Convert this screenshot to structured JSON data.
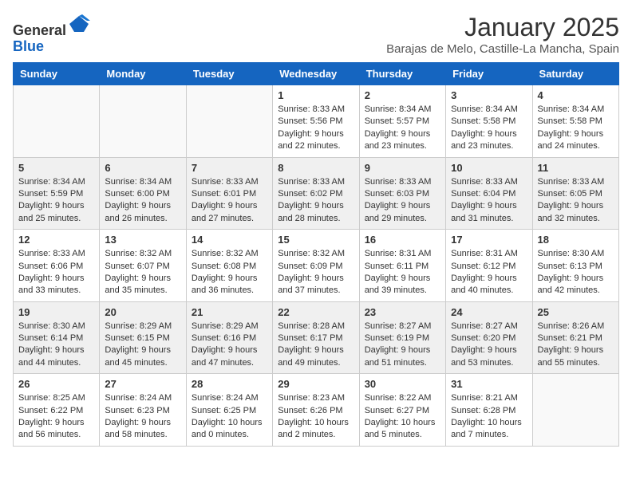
{
  "header": {
    "logo_general": "General",
    "logo_blue": "Blue",
    "month_title": "January 2025",
    "location": "Barajas de Melo, Castille-La Mancha, Spain"
  },
  "days_of_week": [
    "Sunday",
    "Monday",
    "Tuesday",
    "Wednesday",
    "Thursday",
    "Friday",
    "Saturday"
  ],
  "weeks": [
    [
      {
        "day": "",
        "info": ""
      },
      {
        "day": "",
        "info": ""
      },
      {
        "day": "",
        "info": ""
      },
      {
        "day": "1",
        "info": "Sunrise: 8:33 AM\nSunset: 5:56 PM\nDaylight: 9 hours\nand 22 minutes."
      },
      {
        "day": "2",
        "info": "Sunrise: 8:34 AM\nSunset: 5:57 PM\nDaylight: 9 hours\nand 23 minutes."
      },
      {
        "day": "3",
        "info": "Sunrise: 8:34 AM\nSunset: 5:58 PM\nDaylight: 9 hours\nand 23 minutes."
      },
      {
        "day": "4",
        "info": "Sunrise: 8:34 AM\nSunset: 5:58 PM\nDaylight: 9 hours\nand 24 minutes."
      }
    ],
    [
      {
        "day": "5",
        "info": "Sunrise: 8:34 AM\nSunset: 5:59 PM\nDaylight: 9 hours\nand 25 minutes."
      },
      {
        "day": "6",
        "info": "Sunrise: 8:34 AM\nSunset: 6:00 PM\nDaylight: 9 hours\nand 26 minutes."
      },
      {
        "day": "7",
        "info": "Sunrise: 8:33 AM\nSunset: 6:01 PM\nDaylight: 9 hours\nand 27 minutes."
      },
      {
        "day": "8",
        "info": "Sunrise: 8:33 AM\nSunset: 6:02 PM\nDaylight: 9 hours\nand 28 minutes."
      },
      {
        "day": "9",
        "info": "Sunrise: 8:33 AM\nSunset: 6:03 PM\nDaylight: 9 hours\nand 29 minutes."
      },
      {
        "day": "10",
        "info": "Sunrise: 8:33 AM\nSunset: 6:04 PM\nDaylight: 9 hours\nand 31 minutes."
      },
      {
        "day": "11",
        "info": "Sunrise: 8:33 AM\nSunset: 6:05 PM\nDaylight: 9 hours\nand 32 minutes."
      }
    ],
    [
      {
        "day": "12",
        "info": "Sunrise: 8:33 AM\nSunset: 6:06 PM\nDaylight: 9 hours\nand 33 minutes."
      },
      {
        "day": "13",
        "info": "Sunrise: 8:32 AM\nSunset: 6:07 PM\nDaylight: 9 hours\nand 35 minutes."
      },
      {
        "day": "14",
        "info": "Sunrise: 8:32 AM\nSunset: 6:08 PM\nDaylight: 9 hours\nand 36 minutes."
      },
      {
        "day": "15",
        "info": "Sunrise: 8:32 AM\nSunset: 6:09 PM\nDaylight: 9 hours\nand 37 minutes."
      },
      {
        "day": "16",
        "info": "Sunrise: 8:31 AM\nSunset: 6:11 PM\nDaylight: 9 hours\nand 39 minutes."
      },
      {
        "day": "17",
        "info": "Sunrise: 8:31 AM\nSunset: 6:12 PM\nDaylight: 9 hours\nand 40 minutes."
      },
      {
        "day": "18",
        "info": "Sunrise: 8:30 AM\nSunset: 6:13 PM\nDaylight: 9 hours\nand 42 minutes."
      }
    ],
    [
      {
        "day": "19",
        "info": "Sunrise: 8:30 AM\nSunset: 6:14 PM\nDaylight: 9 hours\nand 44 minutes."
      },
      {
        "day": "20",
        "info": "Sunrise: 8:29 AM\nSunset: 6:15 PM\nDaylight: 9 hours\nand 45 minutes."
      },
      {
        "day": "21",
        "info": "Sunrise: 8:29 AM\nSunset: 6:16 PM\nDaylight: 9 hours\nand 47 minutes."
      },
      {
        "day": "22",
        "info": "Sunrise: 8:28 AM\nSunset: 6:17 PM\nDaylight: 9 hours\nand 49 minutes."
      },
      {
        "day": "23",
        "info": "Sunrise: 8:27 AM\nSunset: 6:19 PM\nDaylight: 9 hours\nand 51 minutes."
      },
      {
        "day": "24",
        "info": "Sunrise: 8:27 AM\nSunset: 6:20 PM\nDaylight: 9 hours\nand 53 minutes."
      },
      {
        "day": "25",
        "info": "Sunrise: 8:26 AM\nSunset: 6:21 PM\nDaylight: 9 hours\nand 55 minutes."
      }
    ],
    [
      {
        "day": "26",
        "info": "Sunrise: 8:25 AM\nSunset: 6:22 PM\nDaylight: 9 hours\nand 56 minutes."
      },
      {
        "day": "27",
        "info": "Sunrise: 8:24 AM\nSunset: 6:23 PM\nDaylight: 9 hours\nand 58 minutes."
      },
      {
        "day": "28",
        "info": "Sunrise: 8:24 AM\nSunset: 6:25 PM\nDaylight: 10 hours\nand 0 minutes."
      },
      {
        "day": "29",
        "info": "Sunrise: 8:23 AM\nSunset: 6:26 PM\nDaylight: 10 hours\nand 2 minutes."
      },
      {
        "day": "30",
        "info": "Sunrise: 8:22 AM\nSunset: 6:27 PM\nDaylight: 10 hours\nand 5 minutes."
      },
      {
        "day": "31",
        "info": "Sunrise: 8:21 AM\nSunset: 6:28 PM\nDaylight: 10 hours\nand 7 minutes."
      },
      {
        "day": "",
        "info": ""
      }
    ]
  ]
}
